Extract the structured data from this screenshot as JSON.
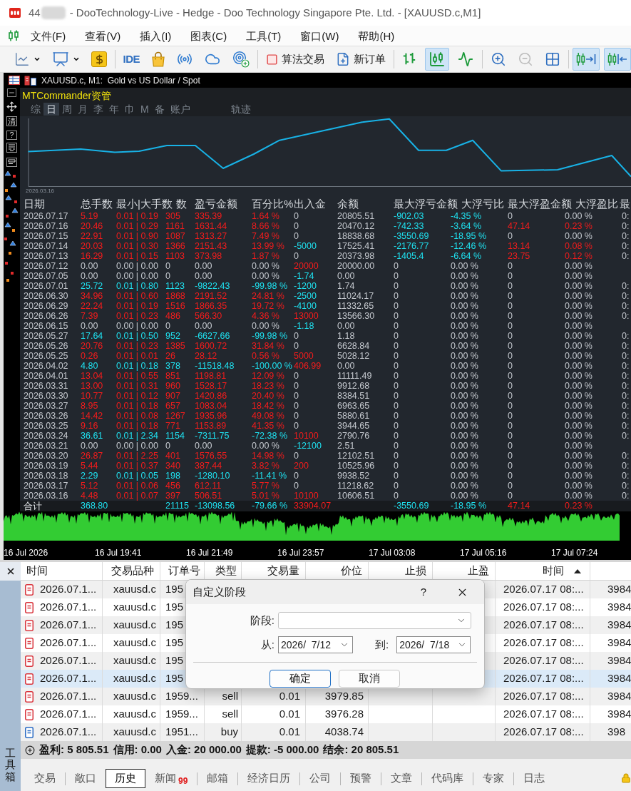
{
  "title_bar": {
    "account": "44",
    "title": "- DooTechnology-Live - Hedge - Doo Technology Singapore Pte. Ltd. - [XAUUSD.c,M1]"
  },
  "menu": [
    "文件(F)",
    "查看(V)",
    "插入(I)",
    "图表(C)",
    "工具(T)",
    "窗口(W)",
    "帮助(H)"
  ],
  "toolbar": [
    [
      {
        "pressed": false,
        "disabled": false
      },
      {
        "pressed": false,
        "disabled": false
      },
      {
        "pressed": false,
        "disabled": false
      }
    ],
    [
      {
        "label": "IDE",
        "pressed": false,
        "disabled": false
      },
      {
        "pressed": false,
        "disabled": false
      },
      {
        "pressed": false,
        "disabled": false
      },
      {
        "pressed": false,
        "disabled": false
      },
      {
        "pressed": false,
        "disabled": false
      }
    ],
    [
      {
        "label": "算法交易",
        "pressed": false,
        "disabled": false
      },
      {
        "label": "新订单",
        "pressed": false,
        "disabled": false
      }
    ],
    [
      {
        "pressed": false,
        "disabled": false
      },
      {
        "pressed": true,
        "disabled": false
      },
      {
        "pressed": false,
        "disabled": false
      }
    ],
    [
      {
        "pressed": false,
        "disabled": false
      },
      {
        "pressed": false,
        "disabled": true
      },
      {
        "pressed": false,
        "disabled": false
      }
    ],
    [
      {
        "pressed": true,
        "disabled": false
      },
      {
        "pressed": true,
        "disabled": false
      }
    ]
  ],
  "chart": {
    "title": "XAUUSD.c, M1:  Gold vs US Dollar / Spot",
    "side_tools": [
      "清",
      "?"
    ],
    "time_axis": [
      "16 Jul 2026",
      "16 Jul 19:41",
      "16 Jul 21:49",
      "16 Jul 23:57",
      "17 Jul 03:08",
      "17 Jul 05:16",
      "17 Jul 07:24"
    ]
  },
  "panel": {
    "title": "MTCommander资管",
    "tabs": [
      {
        "label": "综",
        "selected": false
      },
      {
        "label": "日",
        "selected": true
      },
      {
        "label": "周",
        "selected": false
      },
      {
        "label": "月",
        "selected": false
      },
      {
        "label": "李",
        "selected": false
      },
      {
        "label": "年",
        "selected": false
      },
      {
        "label": "巾",
        "selected": false
      },
      {
        "label": "M",
        "selected": false
      },
      {
        "label": "备",
        "selected": false
      },
      {
        "label": "账户",
        "selected": false
      }
    ],
    "track_tab": {
      "label": "轨迹",
      "selected": false
    },
    "chart_label": "2026.03.16",
    "columns": [
      "日期",
      "总手数",
      "最小|大手数",
      "数",
      "盈亏金额",
      "百分比%",
      "出入金",
      "余额",
      "最大浮亏金额",
      "大浮亏比",
      "最大浮盈金额",
      "大浮盈比",
      "最"
    ],
    "rows": [
      {
        "cells": [
          "2026.07.17",
          "5.19",
          "0.01 | 0.19",
          "305",
          "335.39",
          "1.64 %",
          "0",
          "20805.51",
          "-902.03",
          "-4.35 %",
          "0",
          "0.00 %",
          "0:"
        ],
        "kind": "gain",
        "deposit": false,
        "withdrawal": false,
        "drawdown": true,
        "runup": false
      },
      {
        "cells": [
          "2026.07.16",
          "20.46",
          "0.01 | 0.29",
          "1161",
          "1631.44",
          "8.66 %",
          "0",
          "20470.12",
          "-742.33",
          "-3.64 %",
          "47.14",
          "0.23 %",
          "0:"
        ],
        "kind": "gain",
        "deposit": false,
        "withdrawal": false,
        "drawdown": true,
        "runup": true
      },
      {
        "cells": [
          "2026.07.15",
          "22.91",
          "0.01 | 0.90",
          "1087",
          "1313.27",
          "7.49 %",
          "0",
          "18838.68",
          "-3550.69",
          "-18.95 %",
          "0",
          "0.00 %",
          "0:"
        ],
        "kind": "gain",
        "deposit": false,
        "withdrawal": false,
        "drawdown": true,
        "runup": false
      },
      {
        "cells": [
          "2026.07.14",
          "20.03",
          "0.01 | 0.30",
          "1366",
          "2151.43",
          "13.99 %",
          "-5000",
          "17525.41",
          "-2176.77",
          "-12.46 %",
          "13.14",
          "0.08 %",
          "0:"
        ],
        "kind": "gain",
        "deposit": false,
        "withdrawal": true,
        "drawdown": true,
        "runup": true
      },
      {
        "cells": [
          "2026.07.13",
          "16.29",
          "0.01 | 0.15",
          "1103",
          "373.98",
          "1.87 %",
          "0",
          "20373.98",
          "-1405.4",
          "-6.64 %",
          "23.75",
          "0.12 %",
          "0:"
        ],
        "kind": "gain",
        "deposit": false,
        "withdrawal": false,
        "drawdown": true,
        "runup": true
      },
      {
        "cells": [
          "2026.07.12",
          "0.00",
          "0.00 | 0.00",
          "0",
          "0.00",
          "0.00 %",
          "20000",
          "20000.00",
          "0",
          "0.00 %",
          "0",
          "0.00 %"
        ],
        "kind": "flat",
        "deposit": true,
        "withdrawal": false,
        "drawdown": false,
        "runup": false
      },
      {
        "cells": [
          "2026.07.05",
          "0.00",
          "0.00 | 0.00",
          "0",
          "0.00",
          "0.00 %",
          "-1.74",
          "0.00",
          "0",
          "0.00 %",
          "0",
          "0.00 %"
        ],
        "kind": "flat",
        "deposit": false,
        "withdrawal": true,
        "drawdown": false,
        "runup": false
      },
      {
        "cells": [
          "2026.07.01",
          "25.72",
          "0.01 | 0.80",
          "1123",
          "-9822.43",
          "-99.98 %",
          "-1200",
          "1.74",
          "0",
          "0.00 %",
          "0",
          "0.00 %",
          "0:"
        ],
        "kind": "loss",
        "deposit": false,
        "withdrawal": true,
        "drawdown": false,
        "runup": false
      },
      {
        "cells": [
          "2026.06.30",
          "34.96",
          "0.01 | 0.60",
          "1868",
          "2191.52",
          "24.81 %",
          "-2500",
          "11024.17",
          "0",
          "0.00 %",
          "0",
          "0.00 %",
          "0:"
        ],
        "kind": "gain",
        "deposit": false,
        "withdrawal": true,
        "drawdown": false,
        "runup": false
      },
      {
        "cells": [
          "2026.06.29",
          "22.24",
          "0.01 | 0.19",
          "1516",
          "1866.35",
          "19.72 %",
          "-4100",
          "11332.65",
          "0",
          "0.00 %",
          "0",
          "0.00 %",
          "0:"
        ],
        "kind": "gain",
        "deposit": false,
        "withdrawal": true,
        "drawdown": false,
        "runup": false
      },
      {
        "cells": [
          "2026.06.26",
          "7.39",
          "0.01 | 0.23",
          "486",
          "566.30",
          "4.36 %",
          "13000",
          "13566.30",
          "0",
          "0.00 %",
          "0",
          "0.00 %",
          "0:"
        ],
        "kind": "gain",
        "deposit": true,
        "withdrawal": false,
        "drawdown": false,
        "runup": false
      },
      {
        "cells": [
          "2026.06.15",
          "0.00",
          "0.00 | 0.00",
          "0",
          "0.00",
          "0.00 %",
          "-1.18",
          "0.00",
          "0",
          "0.00 %",
          "0",
          "0.00 %"
        ],
        "kind": "flat",
        "deposit": false,
        "withdrawal": true,
        "drawdown": false,
        "runup": false
      },
      {
        "cells": [
          "2026.05.27",
          "17.64",
          "0.01 | 0.50",
          "952",
          "-6627.66",
          "-99.98 %",
          "0",
          "1.18",
          "0",
          "0.00 %",
          "0",
          "0.00 %",
          "0:"
        ],
        "kind": "loss",
        "deposit": false,
        "withdrawal": false,
        "drawdown": false,
        "runup": false
      },
      {
        "cells": [
          "2026.05.26",
          "20.76",
          "0.01 | 0.23",
          "1385",
          "1600.72",
          "31.84 %",
          "0",
          "6628.84",
          "0",
          "0.00 %",
          "0",
          "0.00 %",
          "0:"
        ],
        "kind": "gain",
        "deposit": false,
        "withdrawal": false,
        "drawdown": false,
        "runup": false
      },
      {
        "cells": [
          "2026.05.25",
          "0.26",
          "0.01 | 0.01",
          "26",
          "28.12",
          "0.56 %",
          "5000",
          "5028.12",
          "0",
          "0.00 %",
          "0",
          "0.00 %",
          "0:"
        ],
        "kind": "gain",
        "deposit": true,
        "withdrawal": false,
        "drawdown": false,
        "runup": false
      },
      {
        "cells": [
          "2026.04.02",
          "4.80",
          "0.01 | 0.18",
          "378",
          "-11518.48",
          "-100.00 %",
          "406.99",
          "0.00",
          "0",
          "0.00 %",
          "0",
          "0.00 %",
          "0:"
        ],
        "kind": "loss",
        "deposit": true,
        "withdrawal": false,
        "drawdown": false,
        "runup": false
      },
      {
        "cells": [
          "2026.04.01",
          "13.04",
          "0.01 | 0.55",
          "851",
          "1198.81",
          "12.09 %",
          "0",
          "11111.49",
          "0",
          "0.00 %",
          "0",
          "0.00 %",
          "0:"
        ],
        "kind": "gain",
        "deposit": false,
        "withdrawal": false,
        "drawdown": false,
        "runup": false
      },
      {
        "cells": [
          "2026.03.31",
          "13.00",
          "0.01 | 0.31",
          "960",
          "1528.17",
          "18.23 %",
          "0",
          "9912.68",
          "0",
          "0.00 %",
          "0",
          "0.00 %",
          "0:"
        ],
        "kind": "gain",
        "deposit": false,
        "withdrawal": false,
        "drawdown": false,
        "runup": false
      },
      {
        "cells": [
          "2026.03.30",
          "10.77",
          "0.01 | 0.12",
          "907",
          "1420.86",
          "20.40 %",
          "0",
          "8384.51",
          "0",
          "0.00 %",
          "0",
          "0.00 %",
          "0:"
        ],
        "kind": "gain",
        "deposit": false,
        "withdrawal": false,
        "drawdown": false,
        "runup": false
      },
      {
        "cells": [
          "2026.03.27",
          "8.95",
          "0.01 | 0.18",
          "657",
          "1083.04",
          "18.42 %",
          "0",
          "6963.65",
          "0",
          "0.00 %",
          "0",
          "0.00 %",
          "0:"
        ],
        "kind": "gain",
        "deposit": false,
        "withdrawal": false,
        "drawdown": false,
        "runup": false
      },
      {
        "cells": [
          "2026.03.26",
          "14.42",
          "0.01 | 0.08",
          "1267",
          "1935.96",
          "49.08 %",
          "0",
          "5880.61",
          "0",
          "0.00 %",
          "0",
          "0.00 %",
          "0:"
        ],
        "kind": "gain",
        "deposit": false,
        "withdrawal": false,
        "drawdown": false,
        "runup": false
      },
      {
        "cells": [
          "2026.03.25",
          "9.16",
          "0.01 | 0.18",
          "771",
          "1153.89",
          "41.35 %",
          "0",
          "3944.65",
          "0",
          "0.00 %",
          "0",
          "0.00 %",
          "0:"
        ],
        "kind": "gain",
        "deposit": false,
        "withdrawal": false,
        "drawdown": false,
        "runup": false
      },
      {
        "cells": [
          "2026.03.24",
          "36.61",
          "0.01 | 2.34",
          "1154",
          "-7311.75",
          "-72.38 %",
          "10100",
          "2790.76",
          "0",
          "0.00 %",
          "0",
          "0.00 %",
          "0:"
        ],
        "kind": "loss",
        "deposit": true,
        "withdrawal": false,
        "drawdown": false,
        "runup": false
      },
      {
        "cells": [
          "2026.03.21",
          "0.00",
          "0.00 | 0.00",
          "0",
          "0.00",
          "0.00 %",
          "-12100",
          "2.51",
          "0",
          "0.00 %",
          "0",
          "0.00 %"
        ],
        "kind": "flat",
        "deposit": false,
        "withdrawal": true,
        "drawdown": false,
        "runup": false
      },
      {
        "cells": [
          "2026.03.20",
          "26.87",
          "0.01 | 2.25",
          "401",
          "1576.55",
          "14.98 %",
          "0",
          "12102.51",
          "0",
          "0.00 %",
          "0",
          "0.00 %",
          "0:"
        ],
        "kind": "gain",
        "deposit": false,
        "withdrawal": false,
        "drawdown": false,
        "runup": false
      },
      {
        "cells": [
          "2026.03.19",
          "5.44",
          "0.01 | 0.37",
          "340",
          "387.44",
          "3.82 %",
          "200",
          "10525.96",
          "0",
          "0.00 %",
          "0",
          "0.00 %",
          "0:"
        ],
        "kind": "gain",
        "deposit": true,
        "withdrawal": false,
        "drawdown": false,
        "runup": false
      },
      {
        "cells": [
          "2026.03.18",
          "2.29",
          "0.01 | 0.05",
          "198",
          "-1280.10",
          "-11.41 %",
          "0",
          "9938.52",
          "0",
          "0.00 %",
          "0",
          "0.00 %",
          "0:"
        ],
        "kind": "loss",
        "deposit": false,
        "withdrawal": false,
        "drawdown": false,
        "runup": false
      },
      {
        "cells": [
          "2026.03.17",
          "5.12",
          "0.01 | 0.06",
          "456",
          "612.11",
          "5.77 %",
          "0",
          "11218.62",
          "0",
          "0.00 %",
          "0",
          "0.00 %",
          "0:"
        ],
        "kind": "gain",
        "deposit": false,
        "withdrawal": false,
        "drawdown": false,
        "runup": false
      },
      {
        "cells": [
          "2026.03.16",
          "4.48",
          "0.01 | 0.07",
          "397",
          "506.51",
          "5.01 %",
          "10100",
          "10606.51",
          "0",
          "0.00 %",
          "0",
          "0.00 %",
          "0:"
        ],
        "kind": "gain",
        "deposit": true,
        "withdrawal": false,
        "drawdown": false,
        "runup": false
      }
    ],
    "total": {
      "label": "合计",
      "lots": "368.80",
      "trades": "21115",
      "pnl": "-13098.56",
      "pct": "-79.66 %",
      "flow_amount": "33904.07",
      "max_float_loss": "-3550.69",
      "max_float_loss_pct": "-18.95 %",
      "max_float_profit": "47.14",
      "max_float_profit_pct": "0.23 %",
      "kind": "loss",
      "deposit": true,
      "withdrawal": false,
      "drawdown": true,
      "runup": true
    }
  },
  "terminal": {
    "toolbox_label": "工具箱",
    "columns": [
      {
        "label": "时间",
        "sorted": false
      },
      {
        "label": "交易品种",
        "sorted": false
      },
      {
        "label": "订单号",
        "sorted": false
      },
      {
        "label": "类型",
        "sorted": false
      },
      {
        "label": "交易量",
        "sorted": false
      },
      {
        "label": "价位",
        "sorted": false
      },
      {
        "label": "止损",
        "sorted": false
      },
      {
        "label": "止盈",
        "sorted": false
      },
      {
        "label": "时间",
        "sorted": true
      }
    ],
    "rows": [
      {
        "kind": "sell",
        "selected": false,
        "time": "2026.07.1...",
        "symbol": "xauusd.c",
        "order": "195",
        "close_time": "2026.07.17 08:...",
        "column_10": "3984"
      },
      {
        "kind": "sell",
        "selected": false,
        "time": "2026.07.1...",
        "symbol": "xauusd.c",
        "order": "195",
        "close_time": "2026.07.17 08:...",
        "column_10": "3984"
      },
      {
        "kind": "sell",
        "selected": false,
        "time": "2026.07.1...",
        "symbol": "xauusd.c",
        "order": "195",
        "close_time": "2026.07.17 08:...",
        "column_10": "3984"
      },
      {
        "kind": "sell",
        "selected": false,
        "time": "2026.07.1...",
        "symbol": "xauusd.c",
        "order": "195",
        "close_time": "2026.07.17 08:...",
        "column_10": "3984"
      },
      {
        "kind": "sell",
        "selected": false,
        "time": "2026.07.1...",
        "symbol": "xauusd.c",
        "order": "195",
        "close_time": "2026.07.17 08:...",
        "column_10": "3984"
      },
      {
        "kind": "sell",
        "selected": true,
        "time": "2026.07.1...",
        "symbol": "xauusd.c",
        "order": "195",
        "close_time": "2026.07.17 08:...",
        "column_10": "3984"
      },
      {
        "kind": "sell",
        "selected": false,
        "time": "2026.07.1...",
        "symbol": "xauusd.c",
        "order": "1959...",
        "type": "sell",
        "volume": "0.01",
        "price": "3979.85",
        "close_time": "2026.07.17 08:...",
        "column_10": "3984"
      },
      {
        "kind": "sell",
        "selected": false,
        "time": "2026.07.1...",
        "symbol": "xauusd.c",
        "order": "1959...",
        "type": "sell",
        "volume": "0.01",
        "price": "3976.28",
        "close_time": "2026.07.17 08:...",
        "column_10": "3984"
      },
      {
        "kind": "buy",
        "selected": false,
        "time": "2026.07.1...",
        "symbol": "xauusd.c",
        "order": "1951...",
        "type": "buy",
        "volume": "0.01",
        "price": "4038.74",
        "close_time": "2026.07.17 08:...",
        "column_10": "398"
      }
    ],
    "summary": [
      "盈利: 5 805.51",
      "信用: 0.00",
      "入金: 20 000.00",
      "提款: -5 000.00",
      "结余: 20 805.51"
    ],
    "tabs": [
      {
        "label": "交易",
        "selected": false
      },
      {
        "label": "敞口",
        "selected": false
      },
      {
        "label": "历史",
        "selected": true
      },
      {
        "label": "新闻",
        "selected": false,
        "badge": "99"
      },
      {
        "label": "邮箱",
        "selected": false
      },
      {
        "label": "经济日历",
        "selected": false
      },
      {
        "label": "公司",
        "selected": false
      },
      {
        "label": "预警",
        "selected": false
      },
      {
        "label": "文章",
        "selected": false
      },
      {
        "label": "代码库",
        "selected": false
      },
      {
        "label": "专家",
        "selected": false
      },
      {
        "label": "日志",
        "selected": false
      }
    ]
  },
  "dialog": {
    "title": "自定义阶段",
    "help": "?",
    "period_label": "阶段:",
    "from_label": "从:",
    "from_value": "2026/  7/12",
    "to_label": "到:",
    "to_value": "2026/  7/18",
    "buttons": [
      {
        "label": "确定",
        "default": true
      },
      {
        "label": "取消",
        "default": false
      }
    ]
  }
}
